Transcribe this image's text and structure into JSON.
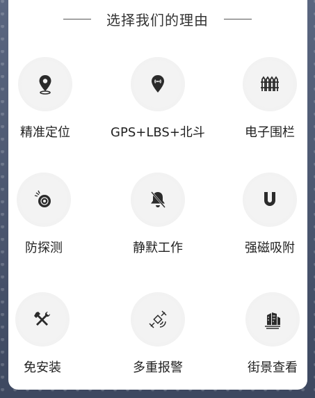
{
  "header": {
    "title": "选择我们的理由"
  },
  "features": [
    {
      "label": "精准定位",
      "icon": "location-pin-icon"
    },
    {
      "label": "GPS+LBS+北斗",
      "icon": "signal-pin-icon"
    },
    {
      "label": "电子围栏",
      "icon": "fence-icon"
    },
    {
      "label": "防探测",
      "icon": "anti-detect-icon"
    },
    {
      "label": "静默工作",
      "icon": "muted-bell-icon"
    },
    {
      "label": "强磁吸附",
      "icon": "magnet-icon"
    },
    {
      "label": "免安装",
      "icon": "tools-icon"
    },
    {
      "label": "多重报警",
      "icon": "satellite-icon"
    },
    {
      "label": "街景查看",
      "icon": "street-view-icon"
    }
  ],
  "colors": {
    "icon": "#2b2b2b",
    "circle": "#eeeeee",
    "text": "#222222"
  }
}
